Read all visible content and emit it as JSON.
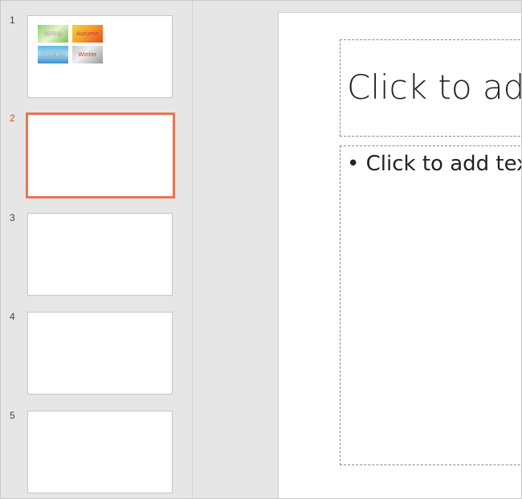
{
  "thumbnails": [
    {
      "number": "1",
      "mini_labels": [
        "Spring",
        "Autumn",
        "Summer",
        "Winter"
      ]
    },
    {
      "number": "2"
    },
    {
      "number": "3"
    },
    {
      "number": "4"
    },
    {
      "number": "5"
    }
  ],
  "selected_slide": "2",
  "slide": {
    "title_placeholder": "Click to add title",
    "body_placeholder": "Click to add text",
    "bullet": "•"
  },
  "colors": {
    "accent": "#e97452",
    "active_number": "#d24726"
  }
}
